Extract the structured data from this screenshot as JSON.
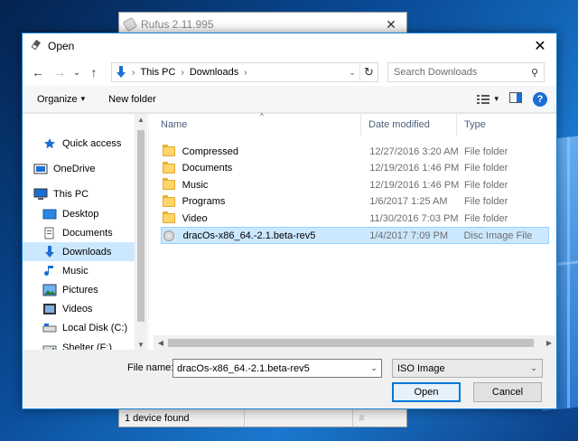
{
  "rufus": {
    "title": "Rufus 2.11.995",
    "close_glyph": "✕",
    "status": "1 device found",
    "grip_glyph": "#"
  },
  "dialog": {
    "title": "Open",
    "close_glyph": "✕",
    "address": {
      "crumbs": [
        "This PC",
        "Downloads"
      ],
      "chevron": "›",
      "dropdown_glyph": "⌄",
      "refresh_glyph": "↻"
    },
    "search": {
      "placeholder": "Search Downloads",
      "glyph": "⚲"
    },
    "toolbar": {
      "organize_label": "Organize",
      "organize_caret": "▾",
      "new_folder_label": "New folder",
      "view_caret": "▾",
      "help_glyph": "?"
    },
    "nav_glyphs": {
      "back": "←",
      "forward": "→",
      "recent": "⌄",
      "up": "↑"
    },
    "nav_pane": {
      "items": [
        {
          "label": "Quick access",
          "icon": "star-icon"
        },
        {
          "label": "OneDrive",
          "icon": "cloud-icon"
        },
        {
          "label": "This PC",
          "icon": "computer-icon"
        },
        {
          "label": "Desktop",
          "icon": "desktop-icon"
        },
        {
          "label": "Documents",
          "icon": "documents-icon"
        },
        {
          "label": "Downloads",
          "icon": "download-icon",
          "selected": true
        },
        {
          "label": "Music",
          "icon": "music-icon"
        },
        {
          "label": "Pictures",
          "icon": "pictures-icon"
        },
        {
          "label": "Videos",
          "icon": "videos-icon"
        },
        {
          "label": "Local Disk (C:)",
          "icon": "disk-icon"
        },
        {
          "label": "Shelter (F:)",
          "icon": "drive-icon"
        }
      ]
    },
    "columns": {
      "name": "Name",
      "date": "Date modified",
      "type": "Type"
    },
    "files": [
      {
        "name": "Compressed",
        "date": "12/27/2016 3:20 AM",
        "type": "File folder",
        "icon": "folder-icon"
      },
      {
        "name": "Documents",
        "date": "12/19/2016 1:46 PM",
        "type": "File folder",
        "icon": "folder-icon"
      },
      {
        "name": "Music",
        "date": "12/19/2016 1:46 PM",
        "type": "File folder",
        "icon": "folder-icon"
      },
      {
        "name": "Programs",
        "date": "1/6/2017 1:25 AM",
        "type": "File folder",
        "icon": "folder-icon"
      },
      {
        "name": "Video",
        "date": "11/30/2016 7:03 PM",
        "type": "File folder",
        "icon": "folder-icon"
      },
      {
        "name": "dracOs-x86_64.-2.1.beta-rev5",
        "date": "1/4/2017 7:09 PM",
        "type": "Disc Image File",
        "icon": "disc-image-icon",
        "selected": true
      }
    ],
    "filename_label": "File name:",
    "filename_value": "dracOs-x86_64.-2.1.beta-rev5",
    "filetype_value": "ISO Image",
    "open_label": "Open",
    "cancel_label": "Cancel",
    "dropdown_glyph": "⌄"
  }
}
